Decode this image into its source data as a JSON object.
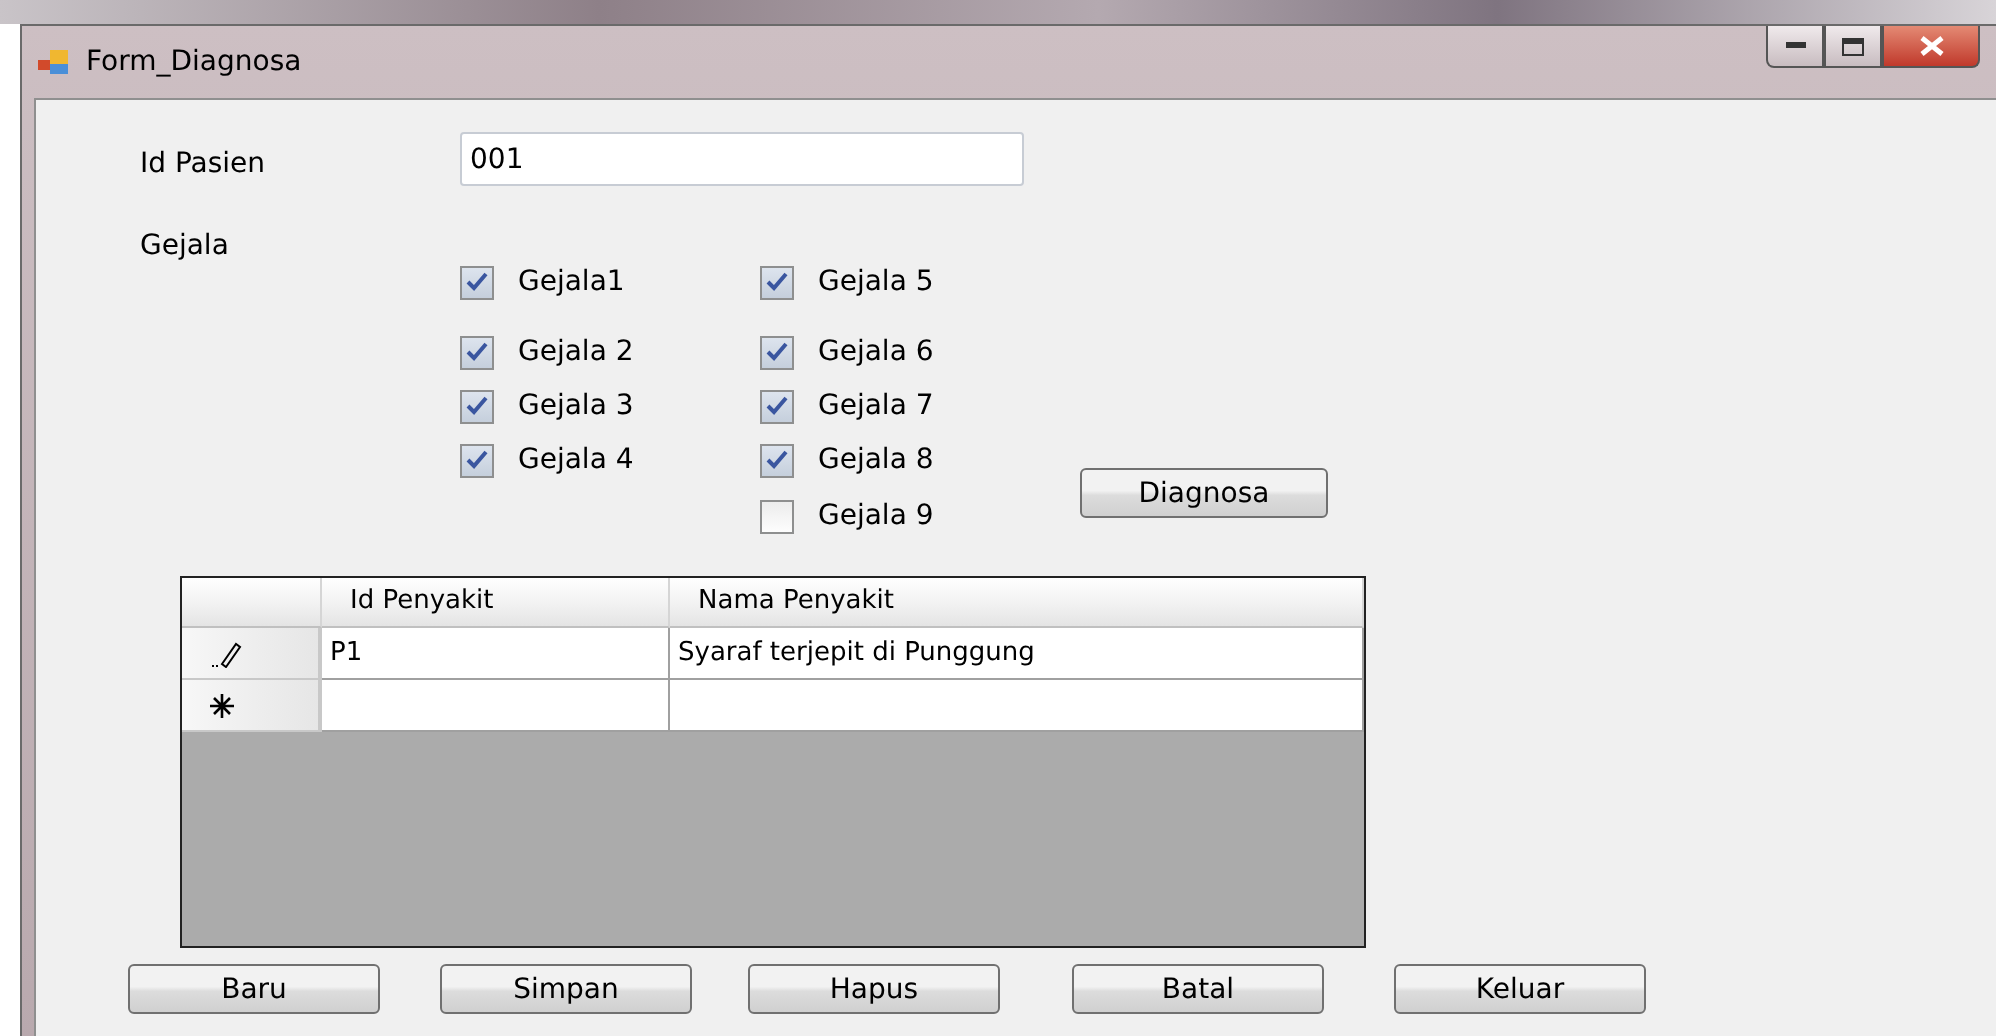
{
  "window": {
    "title": "Form_Diagnosa"
  },
  "id_pasien": {
    "label": "Id Pasien",
    "value": "001"
  },
  "gejala": {
    "label": "Gejala",
    "columns": [
      [
        {
          "label": "Gejala1",
          "checked": true
        },
        {
          "label": "Gejala 2",
          "checked": true
        },
        {
          "label": "Gejala 3",
          "checked": true
        },
        {
          "label": "Gejala 4",
          "checked": true
        }
      ],
      [
        {
          "label": "Gejala 5",
          "checked": true
        },
        {
          "label": "Gejala 6",
          "checked": true
        },
        {
          "label": "Gejala 7",
          "checked": true
        },
        {
          "label": "Gejala 8",
          "checked": true
        },
        {
          "label": "Gejala 9",
          "checked": false
        }
      ]
    ]
  },
  "diagnosa_button": "Diagnosa",
  "table": {
    "columns": [
      "Id Penyakit",
      "Nama  Penyakit"
    ],
    "rows": [
      {
        "kind": "editing",
        "cells": [
          "P1",
          "Syaraf terjepit di Punggung"
        ]
      },
      {
        "kind": "new",
        "cells": [
          "",
          ""
        ]
      }
    ]
  },
  "buttons": [
    "Baru",
    "Simpan",
    "Hapus",
    "Batal",
    "Keluar"
  ]
}
